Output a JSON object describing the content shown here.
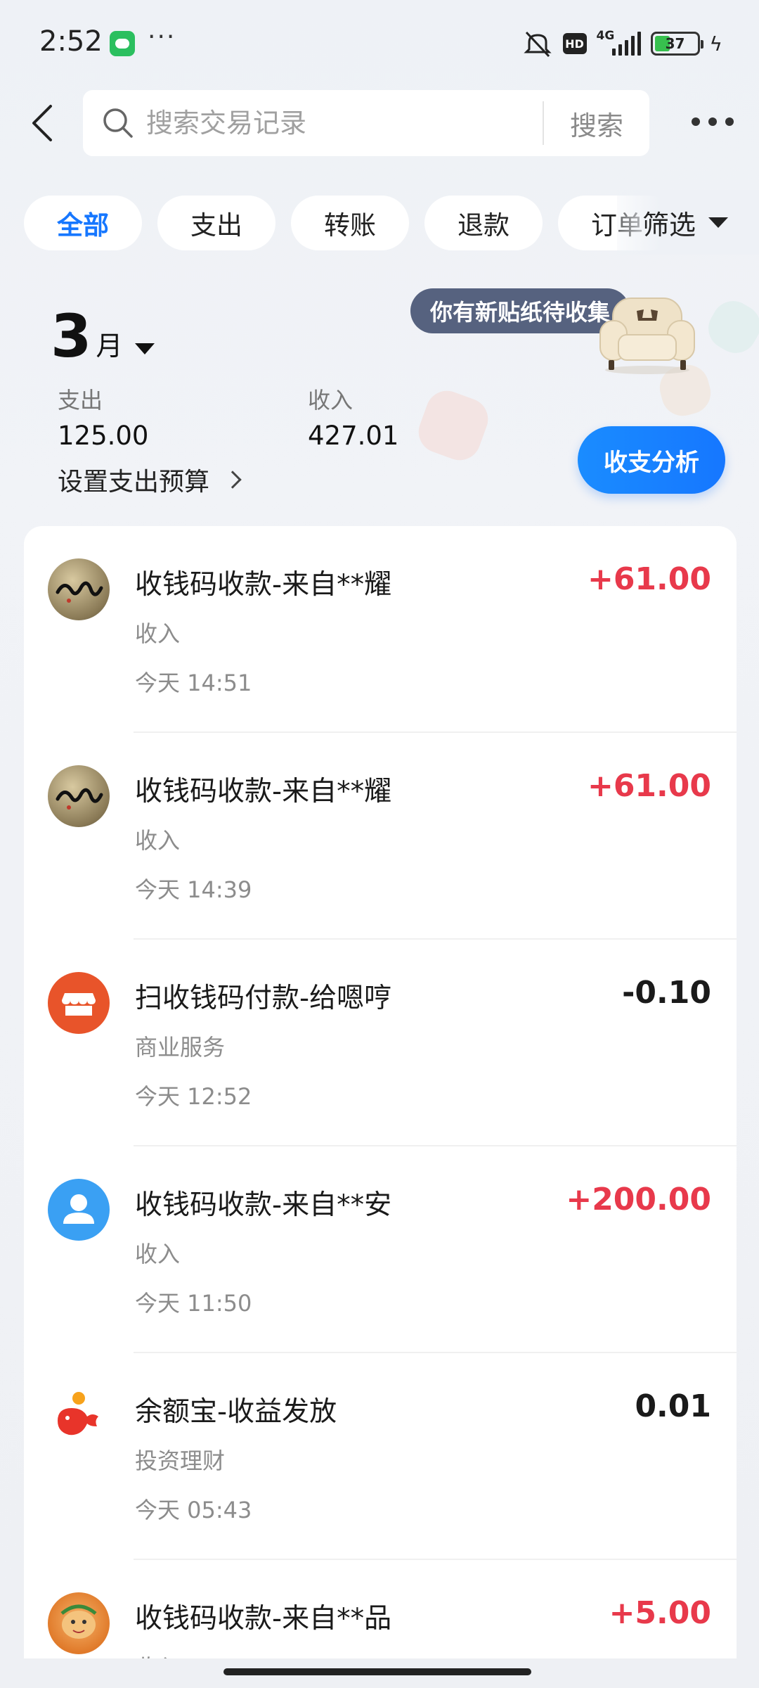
{
  "status_bar": {
    "time": "2:52",
    "dots": "···",
    "network": "4G",
    "hd": "HD",
    "battery": "37",
    "battery_level": 0.37
  },
  "header": {
    "search_placeholder": "搜索交易记录",
    "search_button": "搜索"
  },
  "filters": {
    "chips": [
      "全部",
      "支出",
      "转账",
      "退款",
      "订单"
    ],
    "active_index": 0,
    "filter_label": "筛选"
  },
  "summary": {
    "month_number": "3",
    "month_unit": "月",
    "expense_label": "支出",
    "expense_value": "125.00",
    "income_label": "收入",
    "income_value": "427.01",
    "budget_label": "设置支出预算",
    "sticker_badge": "你有新贴纸待收集",
    "analysis_button": "收支分析"
  },
  "transactions": [
    {
      "title": "收钱码收款-来自**耀",
      "category": "收入",
      "time": "今天 14:51",
      "amount": "+61.00",
      "type": "pos",
      "avatar": "calligraphy-avatar"
    },
    {
      "title": "收钱码收款-来自**耀",
      "category": "收入",
      "time": "今天 14:39",
      "amount": "+61.00",
      "type": "pos",
      "avatar": "calligraphy-avatar"
    },
    {
      "title": "扫收钱码付款-给嗯哼",
      "category": "商业服务",
      "time": "今天 12:52",
      "amount": "-0.10",
      "type": "neg",
      "avatar": "shop-icon"
    },
    {
      "title": "收钱码收款-来自**安",
      "category": "收入",
      "time": "今天 11:50",
      "amount": "+200.00",
      "type": "pos",
      "avatar": "person-icon"
    },
    {
      "title": "余额宝-收益发放",
      "category": "投资理财",
      "time": "今天 05:43",
      "amount": "0.01",
      "type": "neutral",
      "avatar": "yuebao-icon"
    },
    {
      "title": "收钱码收款-来自**品",
      "category": "收入",
      "time": "",
      "amount": "+5.00",
      "type": "pos",
      "avatar": "cartoon-avatar"
    }
  ],
  "colors": {
    "accent": "#1677ff",
    "income": "#e8394b",
    "shop": "#e8542a",
    "person": "#3aa0f3"
  }
}
